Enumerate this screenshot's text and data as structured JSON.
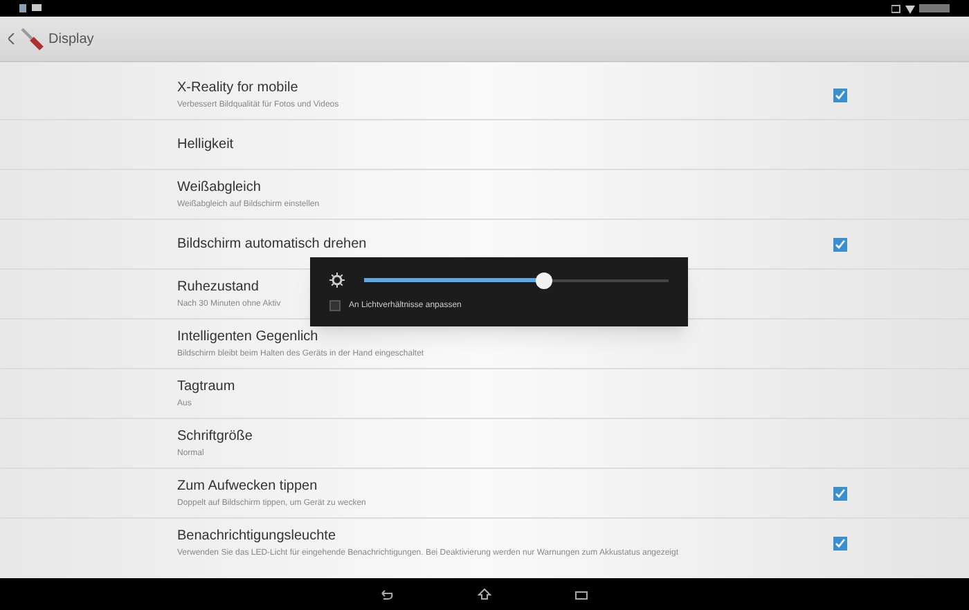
{
  "action_bar": {
    "title": "Display"
  },
  "settings": [
    {
      "title": "X-Reality for mobile",
      "summary": "Verbessert Bildqualität für Fotos und Videos",
      "kind": "checkbox",
      "checked": true
    },
    {
      "title": "Helligkeit",
      "kind": "plain"
    },
    {
      "title": "Weißabgleich",
      "summary": "Weißabgleich auf Bildschirm einstellen",
      "kind": "plain"
    },
    {
      "title": "Bildschirm automatisch drehen",
      "kind": "checkbox",
      "checked": true
    },
    {
      "title": "Ruhezustand",
      "summary": "Nach 30 Minuten ohne Aktiv",
      "kind": "plain"
    },
    {
      "title": "Intelligenten Gegenlich",
      "summary": "Bildschirm bleibt beim Halten des Geräts in der Hand eingeschaltet",
      "kind": "plain"
    },
    {
      "title": "Tagtraum",
      "summary": "Aus",
      "kind": "plain"
    },
    {
      "title": "Schriftgröße",
      "summary": "Normal",
      "kind": "plain"
    },
    {
      "title": "Zum Aufwecken tippen",
      "summary": "Doppelt auf Bildschirm tippen, um Gerät zu wecken",
      "kind": "checkbox",
      "checked": true
    },
    {
      "title": "Benachrichtigungsleuchte",
      "summary": "Verwenden Sie das LED-Licht für eingehende Benachrichtigungen. Bei Deaktivierung werden nur Warnungen zum Akkustatus angezeigt",
      "kind": "checkbox",
      "checked": true
    }
  ],
  "brightness_dialog": {
    "level": 0.59,
    "auto_label": "An Lichtverhältnisse anpassen",
    "auto_checked": false
  }
}
